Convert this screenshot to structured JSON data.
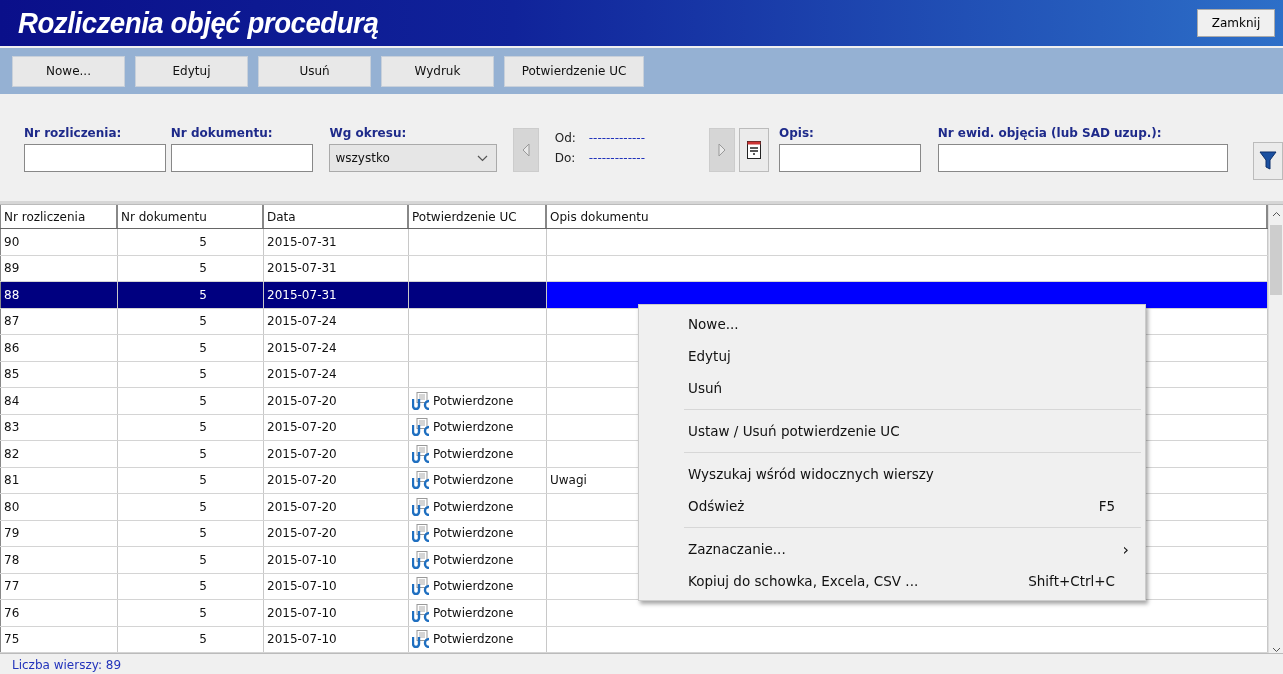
{
  "window": {
    "title": "Rozliczenia objęć procedurą",
    "close_button": "Zamknij"
  },
  "toolbar": [
    "Nowe...",
    "Edytuj",
    "Usuń",
    "Wydruk",
    "Potwierdzenie UC"
  ],
  "filters": {
    "settlement_no": {
      "label": "Nr rozliczenia:"
    },
    "document_no": {
      "label": "Nr dokumentu:"
    },
    "period": {
      "label": "Wg okresu:",
      "value": "wszystko"
    },
    "from": {
      "label": "Od:",
      "value": "-------------"
    },
    "to": {
      "label": "Do:",
      "value": "-------------"
    },
    "description": {
      "label": "Opis:"
    },
    "entry_no": {
      "label": "Nr ewid. objęcia (lub SAD uzup.):"
    }
  },
  "table": {
    "columns": [
      "Nr rozliczenia",
      "Nr dokumentu",
      "Data",
      "Potwierdzenie UC",
      "Opis dokumentu"
    ],
    "rows": [
      {
        "no": "90",
        "doc": "5",
        "date": "2015-07-31",
        "selected": false
      },
      {
        "no": "89",
        "doc": "5",
        "date": "2015-07-31",
        "selected": false
      },
      {
        "no": "88",
        "doc": "5",
        "date": "2015-07-31",
        "selected": true
      },
      {
        "no": "87",
        "doc": "5",
        "date": "2015-07-24",
        "selected": false
      },
      {
        "no": "86",
        "doc": "5",
        "date": "2015-07-24",
        "selected": false
      },
      {
        "no": "85",
        "doc": "5",
        "date": "2015-07-24",
        "selected": false
      },
      {
        "no": "84",
        "doc": "5",
        "date": "2015-07-20",
        "confirmation": "Potwierdzone",
        "selected": false
      },
      {
        "no": "83",
        "doc": "5",
        "date": "2015-07-20",
        "confirmation": "Potwierdzone",
        "selected": false
      },
      {
        "no": "82",
        "doc": "5",
        "date": "2015-07-20",
        "confirmation": "Potwierdzone",
        "selected": false
      },
      {
        "no": "81",
        "doc": "5",
        "date": "2015-07-20",
        "confirmation": "Potwierdzone",
        "description": "Uwagi",
        "selected": false
      },
      {
        "no": "80",
        "doc": "5",
        "date": "2015-07-20",
        "confirmation": "Potwierdzone",
        "selected": false
      },
      {
        "no": "79",
        "doc": "5",
        "date": "2015-07-20",
        "confirmation": "Potwierdzone",
        "selected": false
      },
      {
        "no": "78",
        "doc": "5",
        "date": "2015-07-10",
        "confirmation": "Potwierdzone",
        "selected": false
      },
      {
        "no": "77",
        "doc": "5",
        "date": "2015-07-10",
        "confirmation": "Potwierdzone",
        "selected": false
      },
      {
        "no": "76",
        "doc": "5",
        "date": "2015-07-10",
        "confirmation": "Potwierdzone",
        "selected": false
      },
      {
        "no": "75",
        "doc": "5",
        "date": "2015-07-10",
        "confirmation": "Potwierdzone",
        "selected": false
      }
    ]
  },
  "status_bar": "Liczba wierszy: 89",
  "context_menu": [
    {
      "kind": "item",
      "label": "Nowe..."
    },
    {
      "kind": "item",
      "label": "Edytuj"
    },
    {
      "kind": "item",
      "label": "Usuń"
    },
    {
      "kind": "separator"
    },
    {
      "kind": "item",
      "label": "Ustaw / Usuń potwierdzenie UC"
    },
    {
      "kind": "separator"
    },
    {
      "kind": "item",
      "label": "Wyszukaj wśród widocznych wierszy"
    },
    {
      "kind": "item",
      "label": "Odśwież",
      "shortcut": "F5"
    },
    {
      "kind": "separator"
    },
    {
      "kind": "item",
      "label": "Zaznaczanie...",
      "submenu": "›"
    },
    {
      "kind": "item",
      "label": "Kopiuj do schowka, Excela, CSV ...",
      "shortcut": "Shift+Ctrl+C"
    }
  ]
}
